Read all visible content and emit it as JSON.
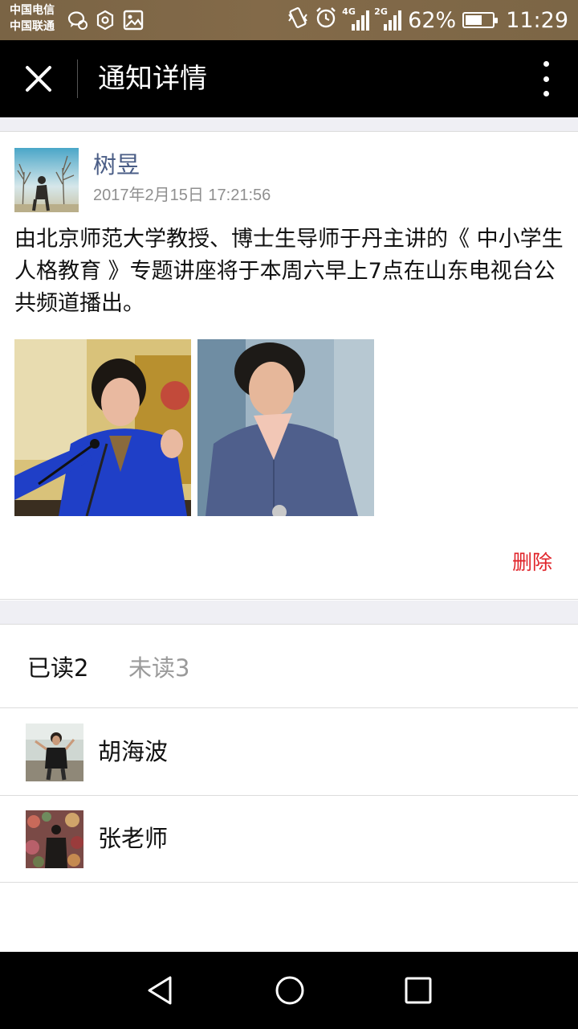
{
  "status_bar": {
    "carrier_1": "中国电信",
    "carrier_2": "中国联通",
    "net_1": "4G",
    "net_2": "2G",
    "battery_text": "62%",
    "battery_level": 0.62,
    "time": "11:29"
  },
  "header": {
    "title": "通知详情",
    "icons": {
      "close": "close-icon",
      "more": "more-vertical-icon"
    }
  },
  "post": {
    "author": "树昱",
    "timestamp": "2017年2月15日 17:21:56",
    "body": "由北京师范大学教授、博士生导师于丹主讲的《 中小学生人格教育 》专题讲座将于本周六早上7点在山东电视台公共频道播出。",
    "delete_label": "删除"
  },
  "tabs": {
    "read": "已读2",
    "unread": "未读3"
  },
  "readers": [
    {
      "name": "胡海波"
    },
    {
      "name": "张老师"
    }
  ],
  "colors": {
    "status_bar": "#7f6848",
    "header": "#000000",
    "author_link": "#4a5d86",
    "delete": "#e0242a",
    "section_gap": "#efeff4"
  }
}
